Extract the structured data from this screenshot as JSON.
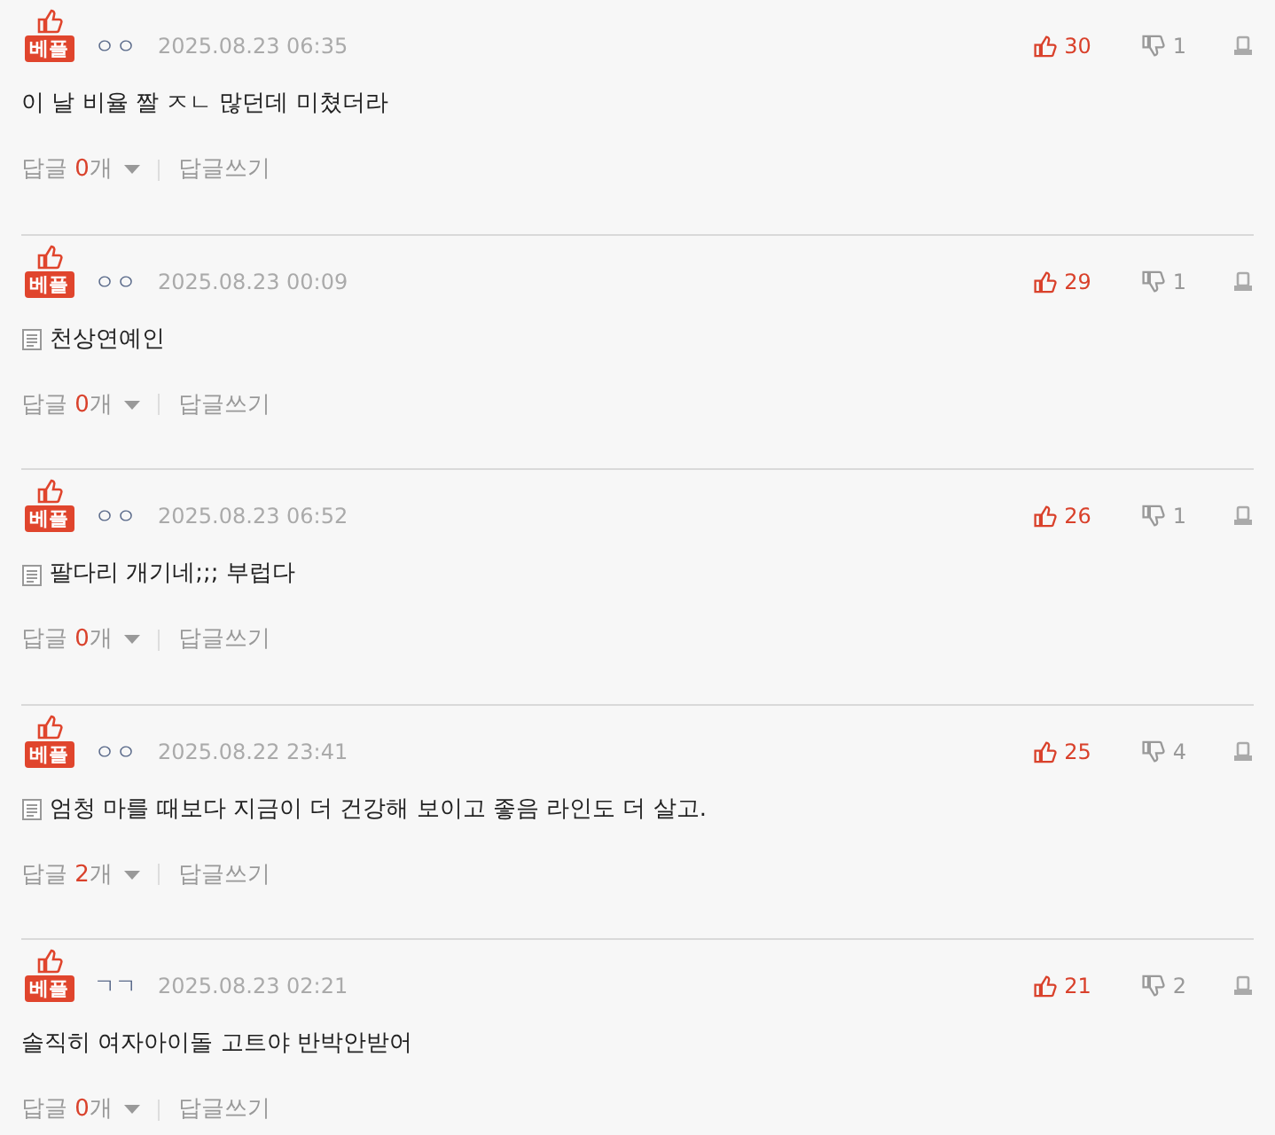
{
  "comments": [
    {
      "badge": "베플",
      "nickname": "ㅇㅇ",
      "date": "2025.08.23 06:35",
      "likes": "30",
      "dislikes": "1",
      "has_attachment": false,
      "text": "이 날 비율 짤 ㅈㄴ 많던데 미쳤더라",
      "reply_label": "답글",
      "reply_count": "0",
      "reply_unit": "개",
      "write_reply": "답글쓰기"
    },
    {
      "badge": "베플",
      "nickname": "ㅇㅇ",
      "date": "2025.08.23 00:09",
      "likes": "29",
      "dislikes": "1",
      "has_attachment": true,
      "text": "천상연예인",
      "reply_label": "답글",
      "reply_count": "0",
      "reply_unit": "개",
      "write_reply": "답글쓰기"
    },
    {
      "badge": "베플",
      "nickname": "ㅇㅇ",
      "date": "2025.08.23 06:52",
      "likes": "26",
      "dislikes": "1",
      "has_attachment": true,
      "text": "팔다리 개기네;;; 부럽다",
      "reply_label": "답글",
      "reply_count": "0",
      "reply_unit": "개",
      "write_reply": "답글쓰기"
    },
    {
      "badge": "베플",
      "nickname": "ㅇㅇ",
      "date": "2025.08.22 23:41",
      "likes": "25",
      "dislikes": "4",
      "has_attachment": true,
      "text": "엄청 마를 때보다 지금이 더 건강해 보이고 좋음 라인도 더 살고.",
      "reply_label": "답글",
      "reply_count": "2",
      "reply_unit": "개",
      "write_reply": "답글쓰기"
    },
    {
      "badge": "베플",
      "nickname": "ㄱㄱ",
      "date": "2025.08.23 02:21",
      "likes": "21",
      "dislikes": "2",
      "has_attachment": false,
      "text": "솔직히 여자아이돌 고트야 반박안받어",
      "reply_label": "답글",
      "reply_count": "0",
      "reply_unit": "개",
      "write_reply": "답글쓰기"
    }
  ]
}
